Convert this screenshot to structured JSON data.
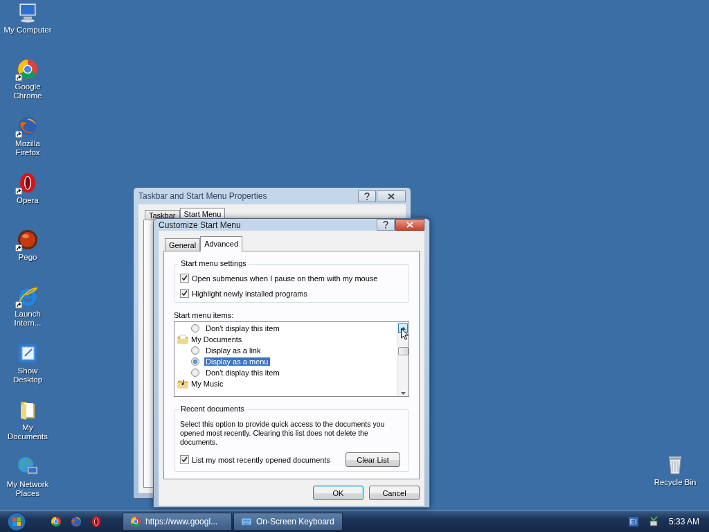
{
  "desktop_icons": [
    {
      "label": "My Computer",
      "kind": "computer",
      "shortcut": false
    },
    {
      "label": "Google Chrome",
      "kind": "chrome",
      "shortcut": true
    },
    {
      "label": "Mozilla Firefox",
      "kind": "firefox",
      "shortcut": true
    },
    {
      "label": "Opera",
      "kind": "opera",
      "shortcut": true
    },
    {
      "label": "Pego",
      "kind": "pego",
      "shortcut": true
    },
    {
      "label": "Launch Intern...",
      "kind": "ie",
      "shortcut": true
    },
    {
      "label": "Show Desktop",
      "kind": "showdesktop",
      "shortcut": false
    },
    {
      "label": "My Documents",
      "kind": "folder",
      "shortcut": false
    },
    {
      "label": "My Network Places",
      "kind": "network",
      "shortcut": false
    },
    {
      "label": "Recycle Bin",
      "kind": "recycle",
      "shortcut": false
    }
  ],
  "back_window": {
    "title": "Taskbar and Start Menu Properties",
    "tabs": [
      {
        "label": "Taskbar",
        "selected": false
      },
      {
        "label": "Start Menu",
        "selected": true
      }
    ]
  },
  "dialog": {
    "title": "Customize Start Menu",
    "tabs": [
      {
        "label": "General",
        "selected": false
      },
      {
        "label": "Advanced",
        "selected": true
      }
    ],
    "settings_group": {
      "title": "Start menu settings",
      "options": [
        {
          "label": "Open submenus when I pause on them with my mouse",
          "checked": true
        },
        {
          "label": "Highlight newly installed programs",
          "checked": true
        }
      ]
    },
    "items_label": "Start menu items:",
    "items": [
      {
        "kind": "radio",
        "label": "Don't display this item",
        "selected": false
      },
      {
        "kind": "documents",
        "label": "My Documents"
      },
      {
        "kind": "radio",
        "label": "Display as a link",
        "selected": false
      },
      {
        "kind": "radio",
        "label": "Display as a menu",
        "selected": true
      },
      {
        "kind": "radio",
        "label": "Don't display this item",
        "selected": false
      },
      {
        "kind": "music",
        "label": "My Music"
      }
    ],
    "recent_group": {
      "title": "Recent documents",
      "description": "Select this option to provide quick access to the documents you opened most recently.  Clearing this list does not delete the documents.",
      "option": {
        "label": "List my most recently opened documents",
        "checked": true
      },
      "button": "Clear List"
    },
    "buttons": [
      "OK",
      "Cancel"
    ]
  },
  "taskbar": {
    "tasks": [
      {
        "label": "https://www.googl...",
        "kind": "chrome"
      },
      {
        "label": "On-Screen Keyboard",
        "kind": "keyboard"
      }
    ],
    "language": "EI",
    "time": "5:33 AM"
  }
}
